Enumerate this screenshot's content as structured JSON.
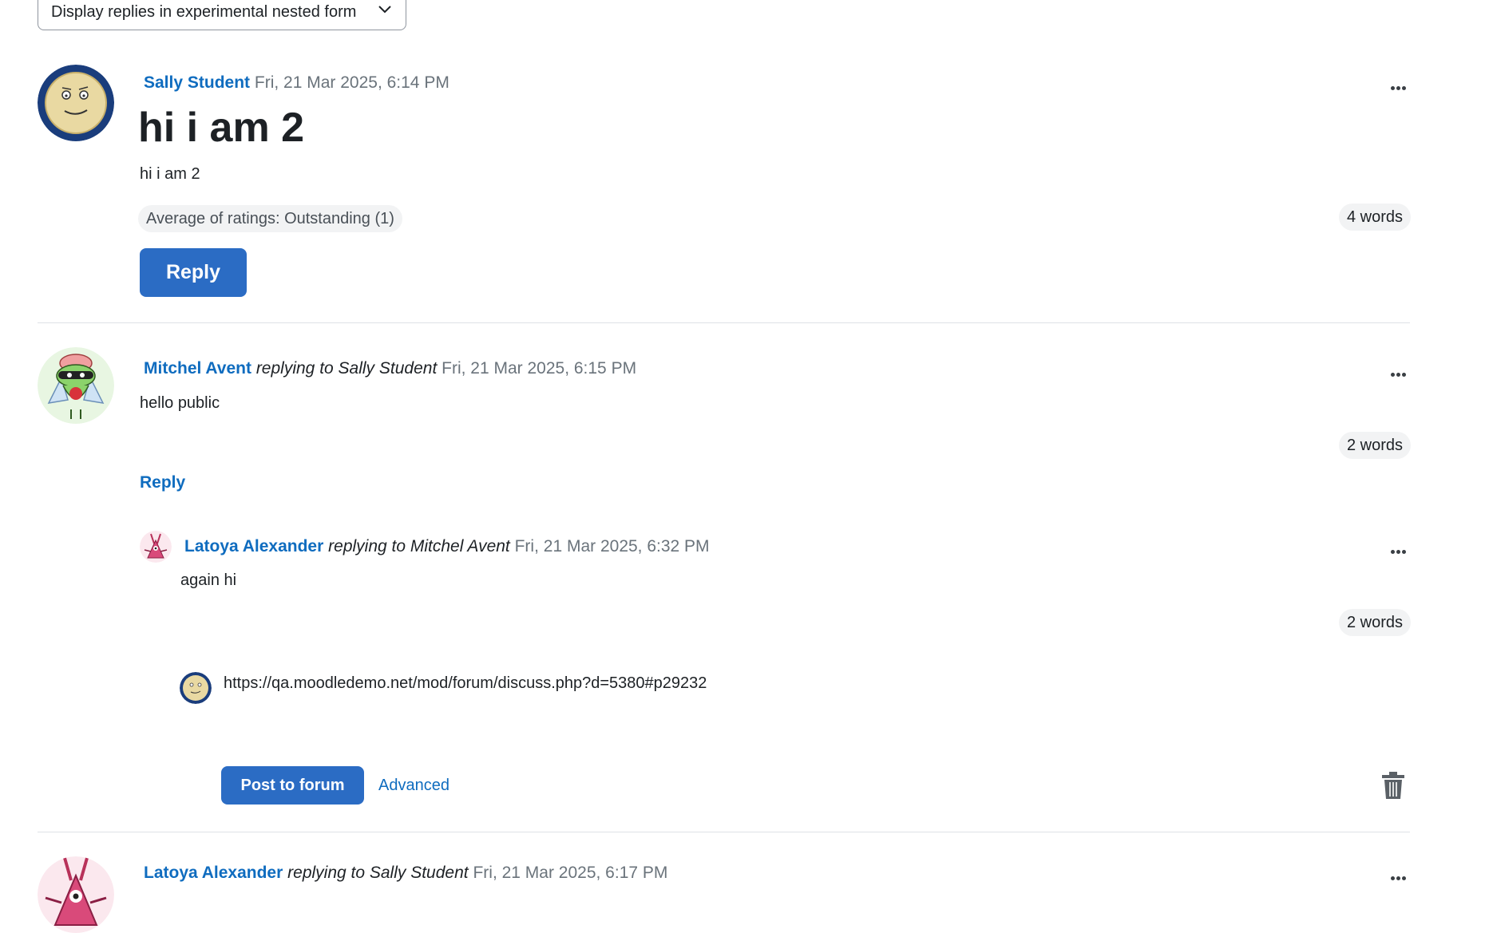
{
  "display_mode": {
    "label": "Display replies in experimental nested form"
  },
  "posts": [
    {
      "author": "Sally Student",
      "replying_to": "",
      "date": "Fri, 21 Mar 2025, 6:14 PM",
      "subject": "hi i am 2",
      "body": "hi i am 2",
      "rating": "Average of ratings: Outstanding (1)",
      "word_count": "4 words",
      "reply_label": "Reply"
    },
    {
      "author": "Mitchel Avent",
      "replying_to": "replying to Sally Student",
      "date": "Fri, 21 Mar 2025, 6:15 PM",
      "body": "hello public",
      "word_count": "2 words",
      "reply_label": "Reply"
    },
    {
      "author": "Latoya Alexander",
      "replying_to": "replying to Mitchel Avent",
      "date": "Fri, 21 Mar 2025, 6:32 PM",
      "body": "again hi",
      "word_count": "2 words"
    },
    {
      "author": "Latoya Alexander",
      "replying_to": "replying to Sally Student",
      "date": "Fri, 21 Mar 2025, 6:17 PM"
    }
  ],
  "inline_reply": {
    "text": "https://qa.moodledemo.net/mod/forum/discuss.php?d=5380#p29232",
    "post_label": "Post to forum",
    "advanced_label": "Advanced"
  },
  "colors": {
    "link": "#0f6cbf",
    "primary_button": "#2b6cc4",
    "muted_text": "#6a737b",
    "pill_background": "#f2f3f4"
  }
}
